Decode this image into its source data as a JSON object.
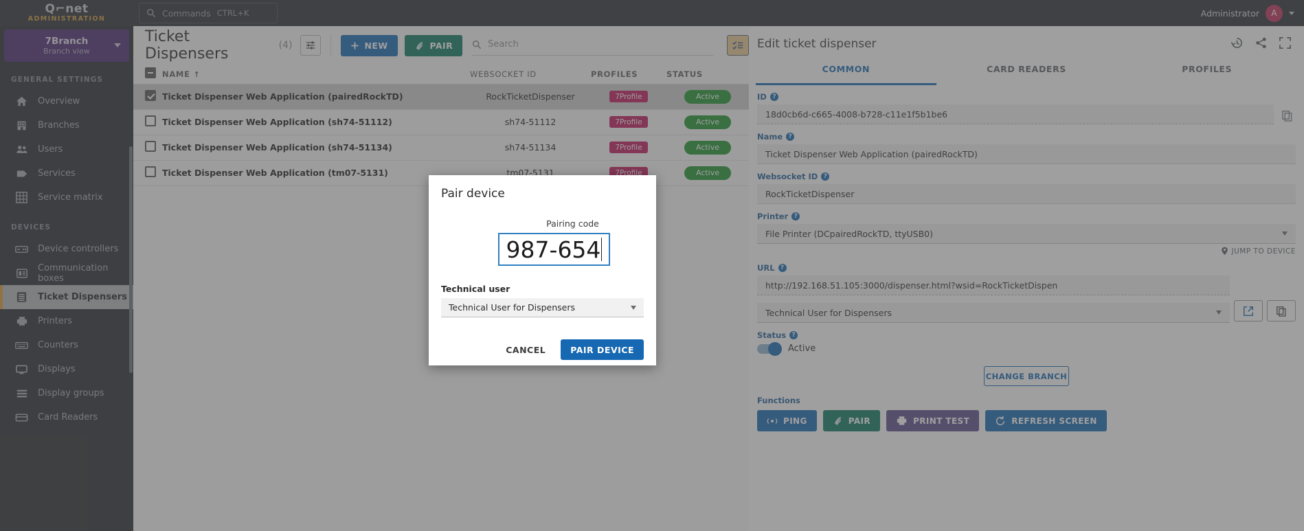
{
  "topbar": {
    "logo": "Q⌐net",
    "logo_sub": "ADMINISTRATION",
    "commands_label": "Commands",
    "commands_shortcut": "CTRL+K",
    "admin_label": "Administrator",
    "avatar_letter": "A"
  },
  "sidebar": {
    "branch_name": "7Branch",
    "branch_view": "Branch view",
    "sections": [
      {
        "title": "GENERAL SETTINGS",
        "items": [
          {
            "label": "Overview",
            "icon": "home-icon"
          },
          {
            "label": "Branches",
            "icon": "building-icon"
          },
          {
            "label": "Users",
            "icon": "users-icon"
          },
          {
            "label": "Services",
            "icon": "tag-icon"
          },
          {
            "label": "Service matrix",
            "icon": "grid-icon"
          }
        ]
      },
      {
        "title": "DEVICES",
        "items": [
          {
            "label": "Device controllers",
            "icon": "controller-icon"
          },
          {
            "label": "Communication boxes",
            "icon": "commbox-icon"
          },
          {
            "label": "Ticket Dispensers",
            "icon": "dispenser-icon",
            "active": true
          },
          {
            "label": "Printers",
            "icon": "printer-icon"
          },
          {
            "label": "Counters",
            "icon": "counter-icon"
          },
          {
            "label": "Displays",
            "icon": "display-icon"
          },
          {
            "label": "Display groups",
            "icon": "display-groups-icon"
          },
          {
            "label": "Card Readers",
            "icon": "card-reader-icon"
          }
        ]
      }
    ]
  },
  "main": {
    "title": "Ticket Dispensers",
    "count": "(4)",
    "new_label": "NEW",
    "pair_label": "PAIR",
    "search_placeholder": "Search",
    "columns": [
      "NAME",
      "WEBSOCKET ID",
      "PROFILES",
      "STATUS"
    ],
    "sort_arrow": "↑",
    "rows": [
      {
        "name": "Ticket Dispenser Web Application (pairedRockTD)",
        "websocket_id": "RockTicketDispenser",
        "profiles": "7Profile",
        "status": "Active",
        "selected": true
      },
      {
        "name": "Ticket Dispenser Web Application (sh74-51112)",
        "websocket_id": "sh74-51112",
        "profiles": "7Profile",
        "status": "Active",
        "selected": false
      },
      {
        "name": "Ticket Dispenser Web Application (sh74-51134)",
        "websocket_id": "sh74-51134",
        "profiles": "7Profile",
        "status": "Active",
        "selected": false
      },
      {
        "name": "Ticket Dispenser Web Application (tm07-5131)",
        "websocket_id": "tm07-5131",
        "profiles": "7Profile",
        "status": "Active",
        "selected": false
      }
    ]
  },
  "right_panel": {
    "title": "Edit ticket dispenser",
    "tabs": [
      {
        "label": "COMMON",
        "active": true
      },
      {
        "label": "CARD READERS",
        "active": false
      },
      {
        "label": "PROFILES",
        "active": false
      }
    ],
    "fields": {
      "id_label": "ID",
      "id_value": "18d0cb6d-c665-4008-b728-c11e1f5b1be6",
      "name_label": "Name",
      "name_value": "Ticket Dispenser Web Application (pairedRockTD)",
      "websocket_label": "Websocket ID",
      "websocket_value": "RockTicketDispenser",
      "printer_label": "Printer",
      "printer_value": "File Printer (DCpairedRockTD, ttyUSB0)",
      "jump_to_device": "JUMP TO DEVICE",
      "url_label": "URL",
      "url_value": "http://192.168.51.105:3000/dispenser.html?wsid=RockTicketDispen",
      "tech_user_value": "Technical User for Dispensers",
      "status_label": "Status",
      "status_value": "Active",
      "change_branch": "CHANGE BRANCH"
    },
    "functions_label": "Functions",
    "functions": [
      {
        "label": "PING",
        "icon": "ping-icon",
        "color": "#1668b3"
      },
      {
        "label": "PAIR",
        "icon": "pair-icon",
        "color": "#0f7b65"
      },
      {
        "label": "PRINT TEST",
        "icon": "printer-icon",
        "color": "#5b4e8e"
      },
      {
        "label": "REFRESH SCREEN",
        "icon": "refresh-icon",
        "color": "#1668b3"
      }
    ]
  },
  "modal": {
    "title": "Pair device",
    "pairing_code_label": "Pairing code",
    "pairing_code_value": "987-654",
    "technical_user_label": "Technical user",
    "technical_user_value": "Technical User for Dispensers",
    "cancel_label": "CANCEL",
    "confirm_label": "PAIR DEVICE"
  },
  "colors": {
    "accent_blue": "#1668b3",
    "accent_teal": "#0f7b65",
    "status_green": "#1e9630",
    "profile_pink": "#c2185b",
    "sidebar_bg": "#272c32",
    "branch_purple": "#4c2a74",
    "active_orange": "#e09b2d"
  }
}
